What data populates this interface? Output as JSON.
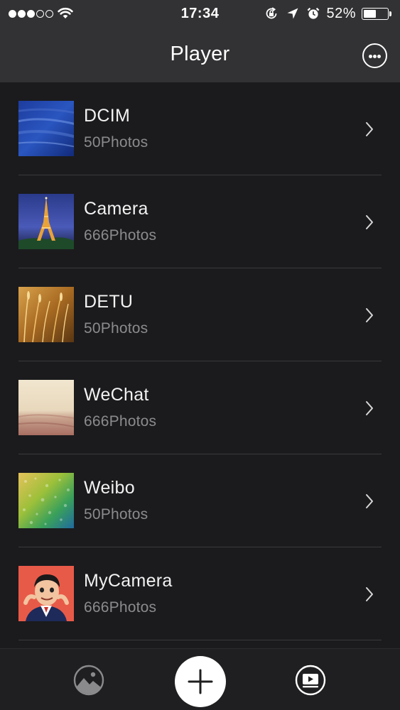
{
  "status_bar": {
    "signal_bars_filled": 3,
    "signal_bars_total": 5,
    "time": "17:34",
    "battery_percent": "52%",
    "battery_level": 0.52,
    "icons": [
      "wifi-icon",
      "orientation-lock-icon",
      "location-icon",
      "alarm-icon",
      "battery-icon"
    ]
  },
  "header": {
    "title": "Player",
    "more_icon": "ellipsis-circle-icon"
  },
  "albums": [
    {
      "name": "DCIM",
      "count": "50Photos"
    },
    {
      "name": "Camera",
      "count": "666Photos"
    },
    {
      "name": "DETU",
      "count": "50Photos"
    },
    {
      "name": "WeChat",
      "count": "666Photos"
    },
    {
      "name": "Weibo",
      "count": "50Photos"
    },
    {
      "name": "MyCamera",
      "count": "666Photos"
    }
  ],
  "tab_bar": {
    "left_icon": "photo-gallery-icon",
    "center_icon": "plus-icon",
    "right_icon": "video-player-icon"
  },
  "colors": {
    "header_bg": "#323234",
    "list_bg": "#1b1b1d",
    "secondary_text": "#8b8b8d",
    "divider": "#3a3a3c"
  }
}
